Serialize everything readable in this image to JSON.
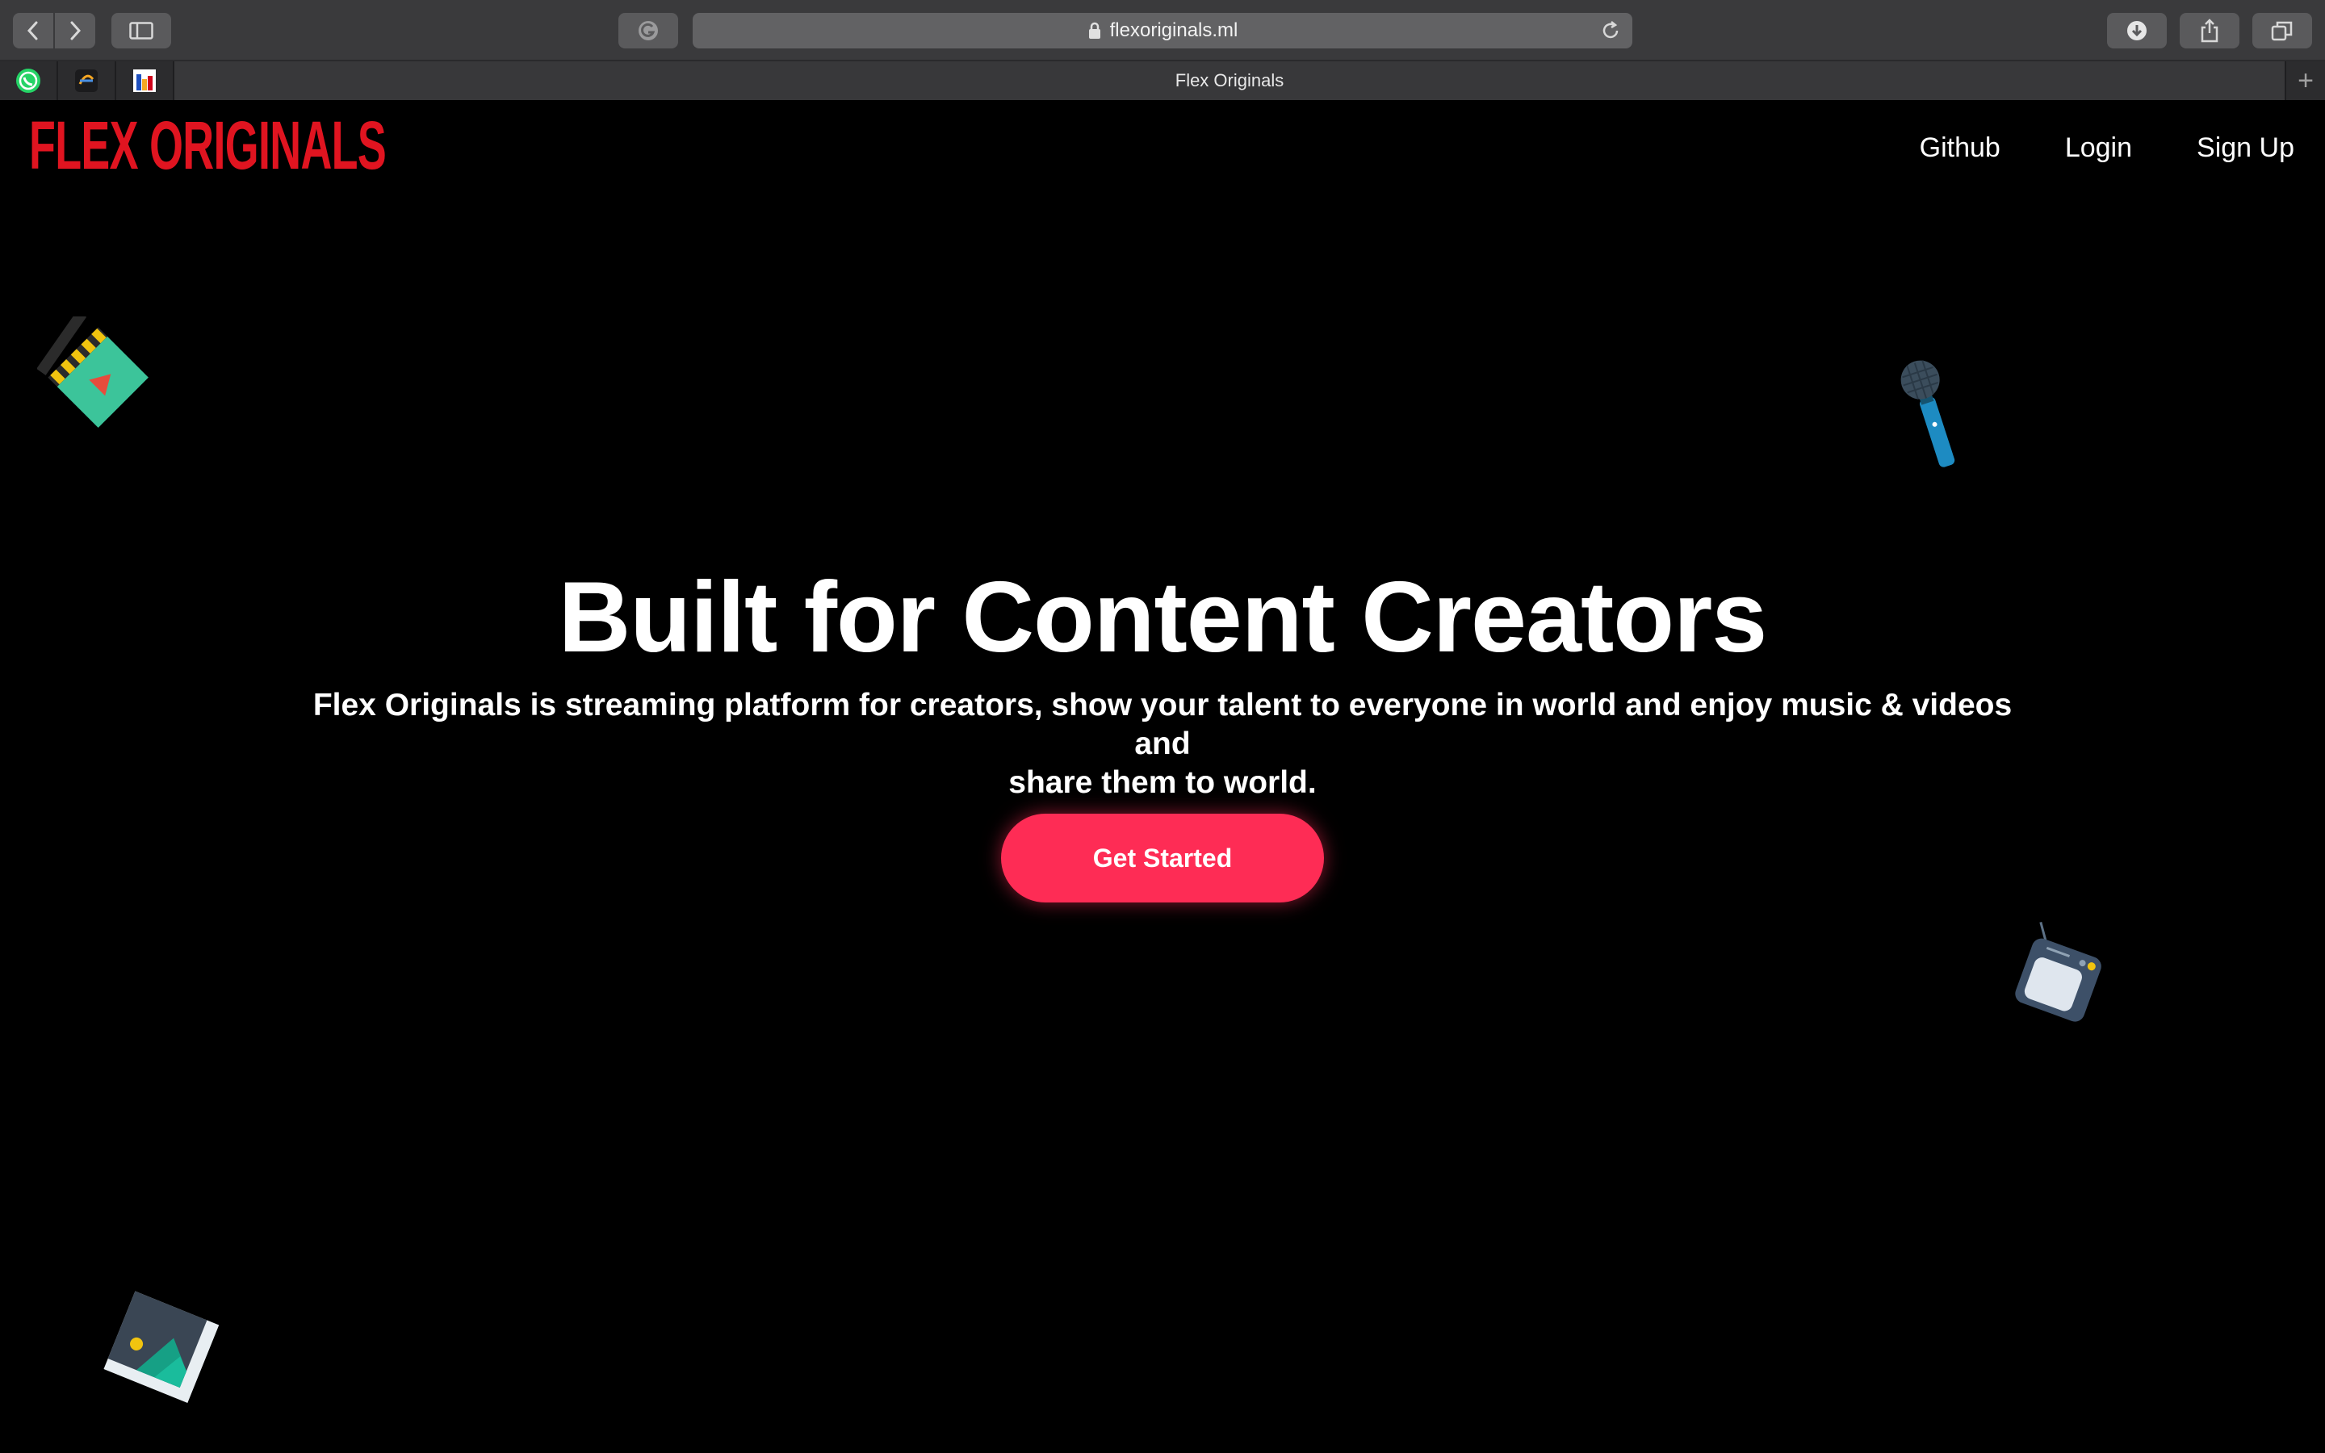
{
  "browser": {
    "url": "flexoriginals.ml",
    "tab_title": "Flex Originals",
    "favicons": [
      "whatsapp-icon",
      "app-icon",
      "chart-icon"
    ],
    "new_tab_label": "+"
  },
  "site": {
    "logo": "FLEX ORIGINALS",
    "nav": {
      "github": "Github",
      "login": "Login",
      "signup": "Sign Up"
    },
    "hero": {
      "title": "Built for Content Creators",
      "subtitle_line1": "Flex Originals is streaming platform for creators, show your talent to everyone in world and enjoy music & videos and",
      "subtitle_line2": "share them to world.",
      "cta": "Get Started"
    }
  },
  "colors": {
    "brand_red": "#e01420",
    "cta_pink": "#fe2c55",
    "background": "#000000"
  },
  "decorations": [
    "clapperboard-icon",
    "microphone-icon",
    "tv-icon",
    "photo-icon"
  ]
}
